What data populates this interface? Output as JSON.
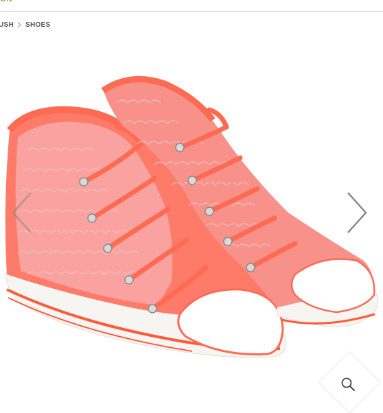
{
  "header": {
    "logo_fragment": "ON"
  },
  "breadcrumb": {
    "previous": "USH",
    "current": "SHOES"
  },
  "gallery": {
    "prev_icon": "chevron-left-icon",
    "next_icon": "chevron-right-icon",
    "zoom_icon": "magnifier-icon"
  },
  "colors": {
    "shoe_coral": "#ff6f5c",
    "sequin_pink": "#f9a2a0",
    "sole_white": "#f7f5f2",
    "stripe_orange": "#ff5a3a",
    "arrow_gray": "#8a8a8a"
  }
}
